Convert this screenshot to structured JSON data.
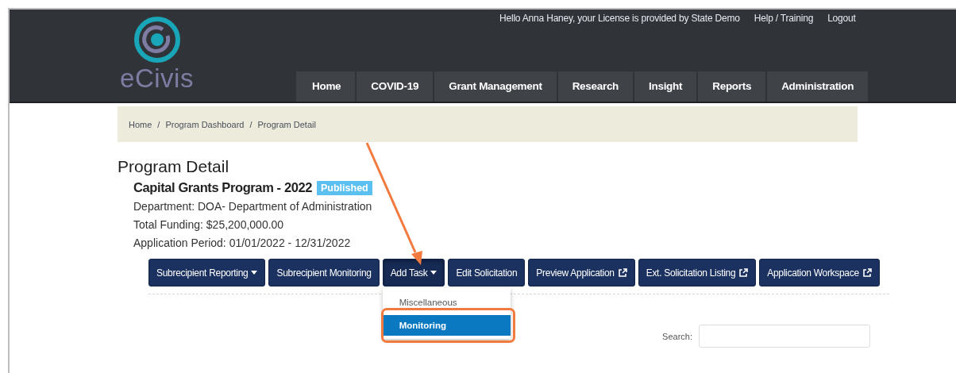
{
  "header": {
    "logo": "eCivis",
    "greeting": "Hello Anna Haney, your License is provided by State Demo",
    "links": [
      "Help / Training",
      "Logout"
    ]
  },
  "nav": [
    "Home",
    "COVID-19",
    "Grant Management",
    "Research",
    "Insight",
    "Reports",
    "Administration"
  ],
  "breadcrumb": [
    "Home",
    "Program Dashboard",
    "Program Detail"
  ],
  "breadcrumb_separator": "/",
  "page_title": "Program Detail",
  "program": {
    "name": "Capital Grants Program - 2022",
    "status": "Published",
    "details": [
      "Department: DOA- Department of Administration",
      "Total Funding: $25,200,000.00",
      "Application Period: 01/01/2022 - 12/31/2022"
    ]
  },
  "actions": [
    {
      "label": "Subrecipient Reporting",
      "kind": "dropdown",
      "expanded": false
    },
    {
      "label": "Subrecipient Monitoring",
      "kind": "plain"
    },
    {
      "label": "Add Task",
      "kind": "dropdown",
      "expanded": true
    },
    {
      "label": "Edit Solicitation",
      "kind": "plain"
    },
    {
      "label": "Preview Application",
      "kind": "external"
    },
    {
      "label": "Ext. Solicitation Listing",
      "kind": "external"
    },
    {
      "label": "Application Workspace",
      "kind": "external"
    }
  ],
  "dropdown": [
    {
      "label": "Miscellaneous",
      "selected": false
    },
    {
      "label": "Monitoring",
      "selected": true
    }
  ],
  "search": {
    "label": "Search:"
  }
}
